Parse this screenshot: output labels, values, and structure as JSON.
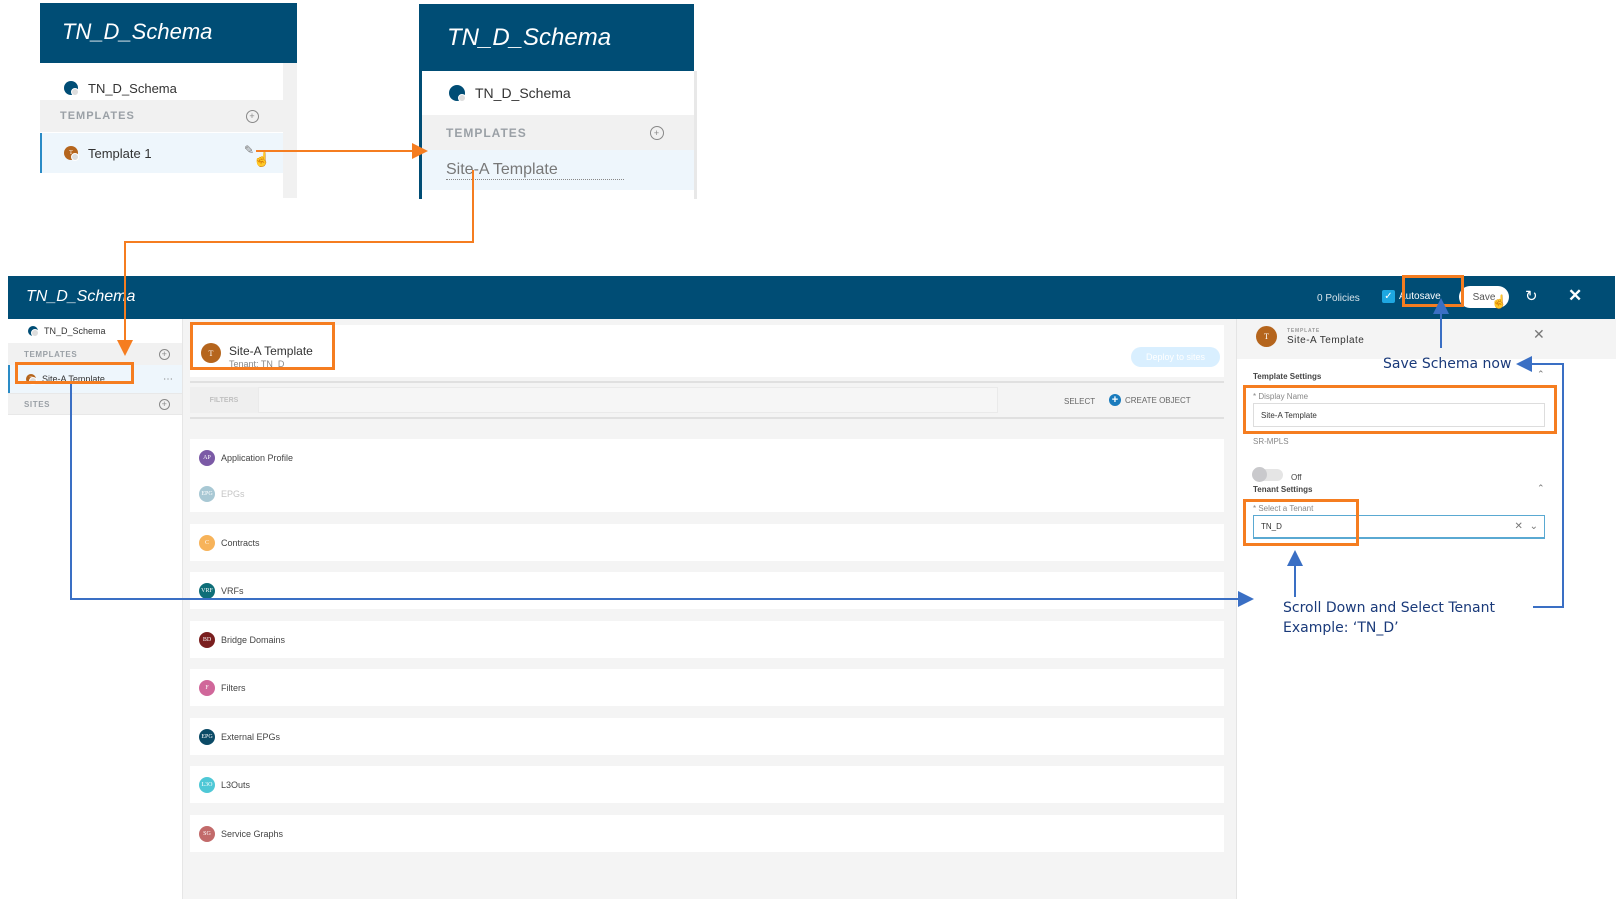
{
  "snapshot_1": {
    "header_title": "TN_D_Schema",
    "schema_name": "TN_D_Schema",
    "templates_label": "TEMPLATES",
    "template_name": "Template 1",
    "edit_icon": "pencil-square-icon",
    "cursor": "hand-pointer-icon"
  },
  "snapshot_2": {
    "header_title": "TN_D_Schema",
    "schema_name": "TN_D_Schema",
    "templates_label": "TEMPLATES",
    "template_name_editing": "Site-A Template"
  },
  "app": {
    "title": "TN_D_Schema",
    "policies": "0 Policies",
    "autosave_label": "Autosave",
    "autosave_checked": true,
    "save_label": "Save",
    "refresh_icon": "refresh-icon",
    "close_icon": "close-icon"
  },
  "sidebar": {
    "schema_name": "TN_D_Schema",
    "templates_label": "TEMPLATES",
    "template_name": "Site-A Template",
    "more_icon": "ellipsis-icon",
    "sites_label": "SITES"
  },
  "template_header": {
    "avatar_letter": "T",
    "name": "Site-A Template",
    "tenant": "Tenant: TN_D",
    "deploy_label": "Deploy to sites"
  },
  "filterbar": {
    "filters_label": "FILTERS",
    "select_label": "SELECT",
    "create_label": "CREATE OBJECT"
  },
  "objects": [
    {
      "abbr": "AP",
      "label": "Application Profile",
      "color": "#7b5aa6",
      "dim": false
    },
    {
      "abbr": "EPG",
      "label": "EPGs",
      "color": "#a8c8d4",
      "dim": true
    },
    {
      "abbr": "C",
      "label": "Contracts",
      "color": "#f7b35a",
      "dim": false
    },
    {
      "abbr": "VRF",
      "label": "VRFs",
      "color": "#0e6e78",
      "dim": false
    },
    {
      "abbr": "BD",
      "label": "Bridge Domains",
      "color": "#7a1f1f",
      "dim": false
    },
    {
      "abbr": "F",
      "label": "Filters",
      "color": "#d0679a",
      "dim": false
    },
    {
      "abbr": "EPG",
      "label": "External EPGs",
      "color": "#0b4a66",
      "dim": false
    },
    {
      "abbr": "L3O",
      "label": "L3Outs",
      "color": "#4fc8d6",
      "dim": false
    },
    {
      "abbr": "SG",
      "label": "Service Graphs",
      "color": "#c26a6a",
      "dim": false
    }
  ],
  "panel": {
    "avatar_letter": "T",
    "kind_label": "TEMPLATE",
    "name": "Site-A Template",
    "template_settings_label": "Template Settings",
    "display_name_label": "* Display Name",
    "display_name_value": "Site-A Template",
    "sr_mpls_label": "SR-MPLS",
    "sr_mpls_state": "Off",
    "tenant_settings_label": "Tenant Settings",
    "tenant_label": "* Select a Tenant",
    "tenant_value": "TN_D"
  },
  "annotations": {
    "save_note": "Save Schema now",
    "tenant_note_line1": "Scroll Down and Select Tenant",
    "tenant_note_line2": "Example: ‘TN_D’"
  },
  "colors": {
    "header": "#004d75",
    "highlight_box": "#f57d20",
    "blue_arrow": "#3a6fc4",
    "accent": "#1ea7e1"
  }
}
